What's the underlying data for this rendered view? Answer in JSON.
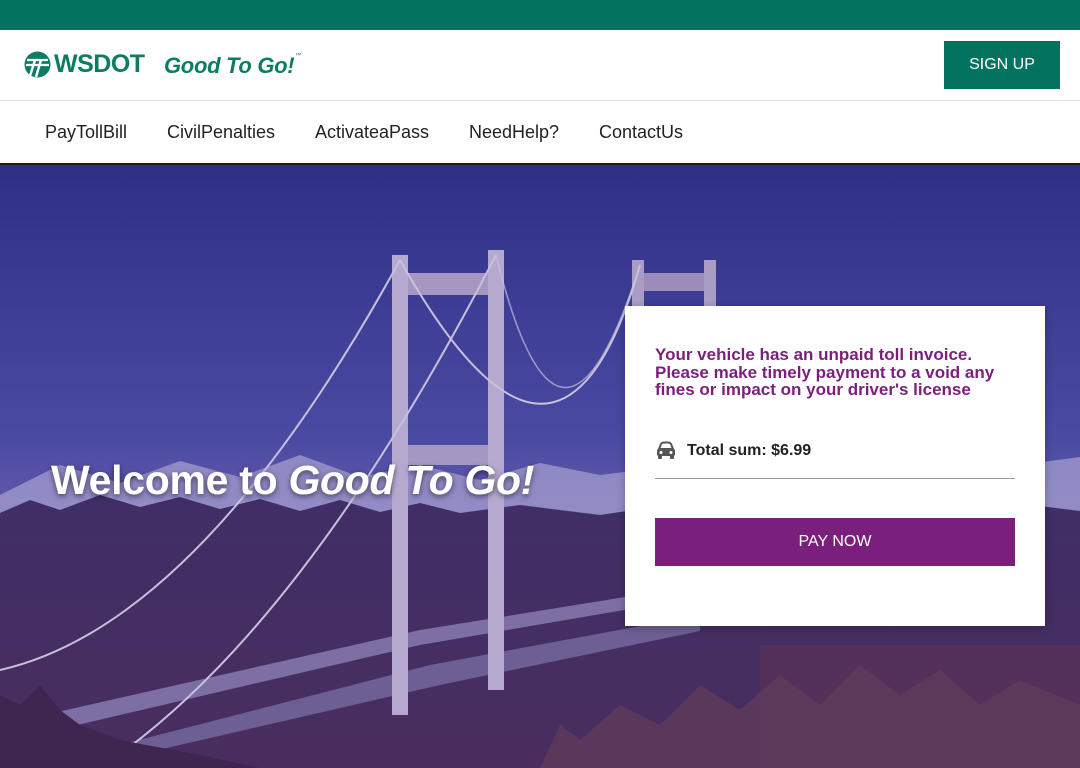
{
  "header": {
    "logo_wsdot": "WSDOT",
    "logo_gtg": "Good To Go!",
    "logo_tm": "™",
    "signup_label": "SIGN UP"
  },
  "nav": {
    "items": [
      {
        "label": "PayTollBill"
      },
      {
        "label": "CivilPenalties"
      },
      {
        "label": "ActivateaPass"
      },
      {
        "label": "NeedHelp?"
      },
      {
        "label": "ContactUs"
      }
    ]
  },
  "hero": {
    "welcome_prefix": "Welcome to ",
    "welcome_brand": "Good To Go!"
  },
  "card": {
    "notice": "Your vehicle has an unpaid toll invoice. Please make timely payment to a void any fines or impact on your driver's license",
    "total_label": "Total sum: $6.99",
    "pay_label": "PAY NOW",
    "car_icon": "car-icon"
  },
  "colors": {
    "brand_green": "#03735f",
    "accent_purple": "#7a1f7c"
  }
}
